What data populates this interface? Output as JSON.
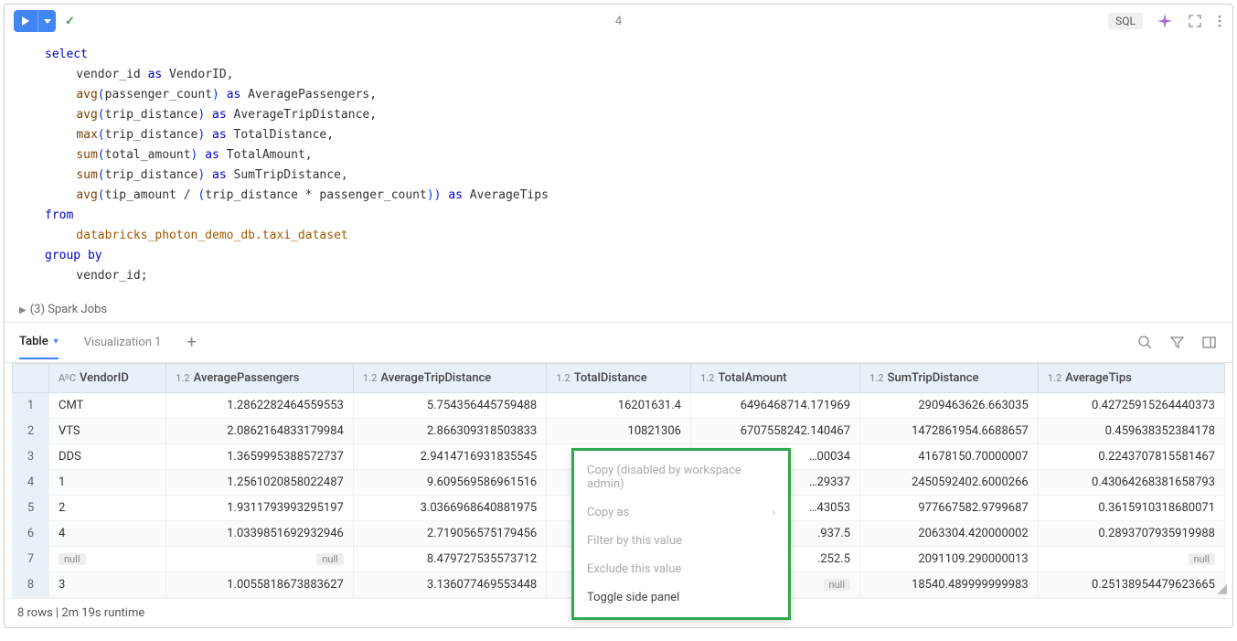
{
  "cell": {
    "number": "4"
  },
  "toolbar": {
    "sql_badge": "SQL"
  },
  "code": {
    "l1": "select",
    "l2a": "    vendor_id ",
    "l2b": "as",
    "l2c": " VendorID,",
    "l3a": "    ",
    "l3f": "avg",
    "l3p1": "(",
    "l3p2": ")",
    "l3b": "passenger_count",
    "l3c": " ",
    "l3d": "as",
    "l3e": " AveragePassengers,",
    "l4a": "    ",
    "l4f": "avg",
    "l4b": "trip_distance",
    "l4d": "as",
    "l4e": " AverageTripDistance,",
    "l5a": "    ",
    "l5f": "max",
    "l5b": "trip_distance",
    "l5d": "as",
    "l5e": " TotalDistance,",
    "l6a": "    ",
    "l6f": "sum",
    "l6b": "total_amount",
    "l6d": "as",
    "l6e": " TotalAmount,",
    "l7a": "    ",
    "l7f": "sum",
    "l7b": "trip_distance",
    "l7d": "as",
    "l7e": " SumTripDistance,",
    "l8a": "    ",
    "l8f": "avg",
    "l8b": "tip_amount / ",
    "l8p3": "(",
    "l8c": "trip_distance * passenger_count",
    "l8p4": ")",
    "l8d": "as",
    "l8e": " AverageTips",
    "l9": "from",
    "l10": "    databricks_photon_demo_db.taxi_dataset",
    "l11": "group by",
    "l12": "    vendor_id;"
  },
  "spark_jobs": "(3) Spark Jobs",
  "tabs": {
    "table": "Table",
    "viz1": "Visualization 1"
  },
  "columns": {
    "vendor": "VendorID",
    "avgpass": "AveragePassengers",
    "avgtrip": "AverageTripDistance",
    "totaldist": "TotalDistance",
    "totalamt": "TotalAmount",
    "sumtrip": "SumTripDistance",
    "avgtips": "AverageTips"
  },
  "type_labels": {
    "str": "AᴮC",
    "num": "1.2"
  },
  "rows": [
    {
      "n": "1",
      "vendor": "CMT",
      "avgpass": "1.2862282464559553",
      "avgtrip": "5.754356445759488",
      "totaldist": "16201631.4",
      "totalamt": "6496468714.171969",
      "sumtrip": "2909463626.663035",
      "avgtips": "0.42725915264440373"
    },
    {
      "n": "2",
      "vendor": "VTS",
      "avgpass": "2.0862164833179984",
      "avgtrip": "2.866309318503833",
      "totaldist": "10821306",
      "totalamt": "6707558242.140467",
      "sumtrip": "1472861954.6688657",
      "avgtips": "0.459638352384178"
    },
    {
      "n": "3",
      "vendor": "DDS",
      "avgpass": "1.3659995388572737",
      "avgtrip": "2.9414716931835545",
      "totaldist": null,
      "totalamt": "…00034",
      "sumtrip": "41678150.70000007",
      "avgtips": "0.2243707815581467"
    },
    {
      "n": "4",
      "vendor": "1",
      "avgpass": "1.2561020858022487",
      "avgtrip": "9.609569586961516",
      "totaldist": null,
      "totalamt": "…29337",
      "sumtrip": "2450592402.6000266",
      "avgtips": "0.43064268381658793"
    },
    {
      "n": "5",
      "vendor": "2",
      "avgpass": "1.9311793993295197",
      "avgtrip": "3.0366968640881975",
      "totaldist": null,
      "totalamt": "…43053",
      "sumtrip": "977667582.9799687",
      "avgtips": "0.3615910318680071"
    },
    {
      "n": "6",
      "vendor": "4",
      "avgpass": "1.0339851692932946",
      "avgtrip": "2.719056575179456",
      "totaldist": null,
      "totalamt": ".937.5",
      "sumtrip": "2063304.420000002",
      "avgtips": "0.2893707935919988"
    },
    {
      "n": "7",
      "vendor": "__null__",
      "avgpass": "__null__",
      "avgtrip": "8.479727535573712",
      "totaldist": null,
      "totalamt": ".252.5",
      "sumtrip": "2091109.290000013",
      "avgtips": "__null__"
    },
    {
      "n": "8",
      "vendor": "3",
      "avgpass": "1.0055818673883627",
      "avgtrip": "3.136077469553448",
      "totaldist": null,
      "totalamt": "__null__",
      "sumtrip": "18540.489999999983",
      "avgtips": "0.25138954479623665"
    }
  ],
  "null_label": "null",
  "context_menu": {
    "copy_disabled": "Copy (disabled by workspace admin)",
    "copy_as": "Copy as",
    "filter": "Filter by this value",
    "exclude": "Exclude this value",
    "toggle": "Toggle side panel"
  },
  "status": {
    "rows": "8 rows",
    "runtime": "2m 19s runtime",
    "sep": "  |  "
  }
}
